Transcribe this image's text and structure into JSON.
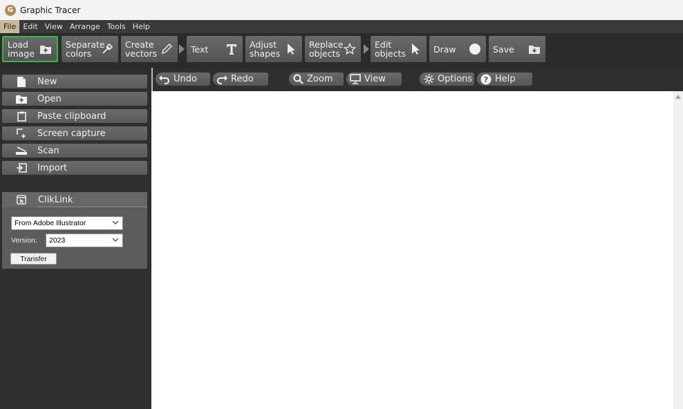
{
  "window": {
    "title": "Graphic Tracer",
    "logo_letter": "G"
  },
  "menu": [
    "File",
    "Edit",
    "View",
    "Arrange",
    "Tools",
    "Help"
  ],
  "toolbar": {
    "load_image": "Load\nimage",
    "separate_colors": "Separate\ncolors",
    "create_vectors": "Create\nvectors",
    "text": "Text",
    "adjust_shapes": "Adjust\nshapes",
    "replace_objects": "Replace\nobjects",
    "edit_objects": "Edit\nobjects",
    "draw": "Draw",
    "save": "Save"
  },
  "sidebar": {
    "items": [
      "New",
      "Open",
      "Paste clipboard",
      "Screen capture",
      "Scan",
      "Import"
    ]
  },
  "cliklink": {
    "title": "ClikLink",
    "source": "From Adobe Illustrator",
    "version_label": "Version:",
    "version": "2023",
    "transfer": "Transfer"
  },
  "subtoolbar": {
    "undo": "Undo",
    "redo": "Redo",
    "zoom": "Zoom",
    "view": "View",
    "options": "Options",
    "help": "Help"
  },
  "colors": {
    "accent_selected": "#3db34a",
    "menu_active": "#c9b89a",
    "button_bg": "#616161",
    "panel_bg": "#2f2f2f"
  }
}
